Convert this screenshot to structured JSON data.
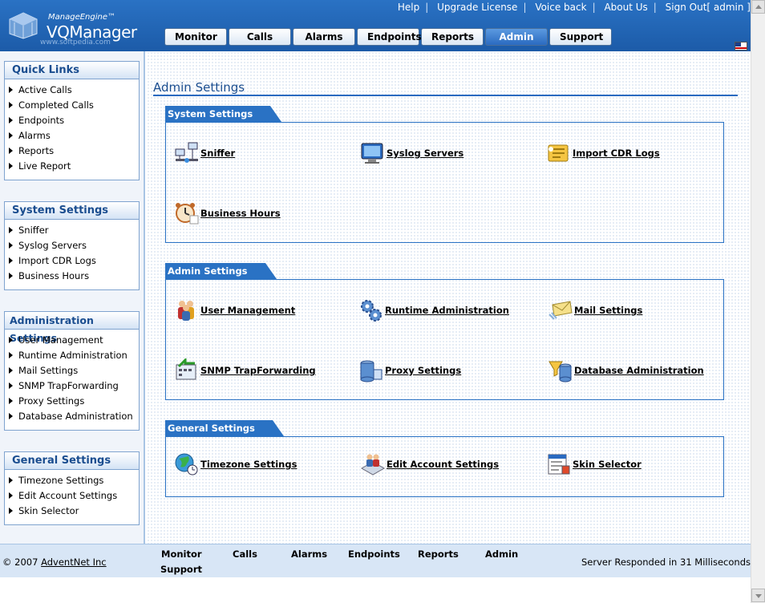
{
  "header": {
    "brand_small": "ManageEngine™",
    "brand_big": "VQManager",
    "watermark": "www.softpedia.com",
    "toplinks": [
      "Help",
      "Upgrade License",
      "Voice back",
      "About Us",
      "Sign Out[ admin ]"
    ],
    "tabs": [
      {
        "label": "Monitor",
        "active": false
      },
      {
        "label": "Calls",
        "active": false
      },
      {
        "label": "Alarms",
        "active": false
      },
      {
        "label": "Endpoints",
        "active": false
      },
      {
        "label": "Reports",
        "active": false
      },
      {
        "label": "Admin",
        "active": true
      },
      {
        "label": "Support",
        "active": false
      }
    ]
  },
  "sidebar": {
    "quick_links": {
      "title": "Quick Links",
      "items": [
        "Active Calls",
        "Completed Calls",
        "Endpoints",
        "Alarms",
        "Reports",
        "Live Report"
      ]
    },
    "system_settings": {
      "title": "System Settings",
      "items": [
        "Sniffer",
        "Syslog Servers",
        "Import CDR Logs",
        "Business Hours"
      ]
    },
    "administration_settings": {
      "title": "Administration Settings",
      "items": [
        "User Management",
        "Runtime Administration",
        "Mail Settings",
        "SNMP TrapForwarding",
        "Proxy Settings",
        "Database Administration"
      ]
    },
    "general_settings": {
      "title": "General Settings",
      "items": [
        "Timezone Settings",
        "Edit Account Settings",
        "Skin Selector"
      ]
    }
  },
  "main": {
    "page_title": "Admin Settings",
    "sections": {
      "system": {
        "title": "System Settings",
        "items": [
          "Sniffer",
          "Syslog Servers",
          "Import CDR Logs",
          "Business Hours"
        ]
      },
      "admin": {
        "title": "Admin Settings",
        "items": [
          "User Management",
          "Runtime Administration",
          "Mail Settings",
          "SNMP TrapForwarding",
          "Proxy Settings",
          "Database Administration"
        ]
      },
      "general": {
        "title": "General Settings",
        "items": [
          "Timezone Settings",
          "Edit Account Settings",
          "Skin Selector"
        ]
      }
    }
  },
  "footer": {
    "copyright_prefix": "© 2007 ",
    "company": "AdventNet Inc",
    "nav": [
      "Monitor",
      "Calls",
      "Alarms",
      "Endpoints",
      "Reports",
      "Admin",
      "Support"
    ],
    "response": "Server Responded in 31 Milliseconds"
  }
}
